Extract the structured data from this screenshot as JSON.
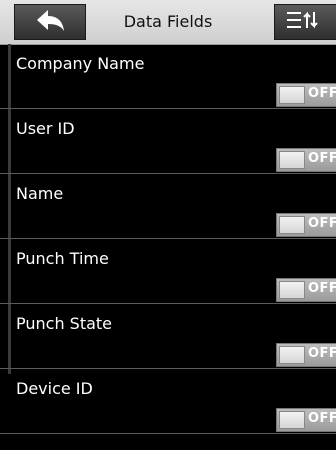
{
  "header": {
    "title": "Data Fields",
    "back_icon": "back-arrow-icon",
    "menu_icon": "sort-menu-icon"
  },
  "fields": [
    {
      "label": "Company Name",
      "state": "OFF"
    },
    {
      "label": "User ID",
      "state": "OFF"
    },
    {
      "label": "Name",
      "state": "OFF"
    },
    {
      "label": "Punch Time",
      "state": "OFF"
    },
    {
      "label": "Punch State",
      "state": "OFF"
    },
    {
      "label": "Device ID",
      "state": "OFF"
    }
  ]
}
